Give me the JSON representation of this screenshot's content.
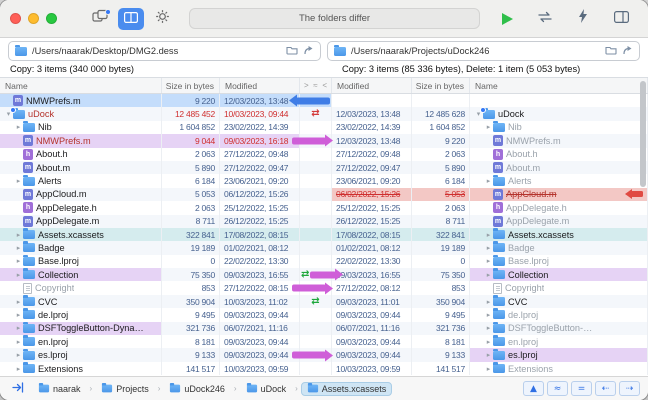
{
  "toolbar": {
    "status_text": "The folders differ",
    "icons": [
      "compare-folders",
      "dual-pane-view",
      "settings",
      "run-sync",
      "swap-sides",
      "actions",
      "layout"
    ]
  },
  "paths": {
    "left": "/Users/naarak/Desktop/DMG2.dess",
    "right": "/Users/naarak/Projects/uDock246"
  },
  "summaries": {
    "left": "Copy: 3 items (340 000 bytes)",
    "right": "Copy: 3 items (85 336 bytes), Delete: 1 item (5 053 bytes)"
  },
  "headers": {
    "left": [
      "Name",
      "Size in bytes",
      "Modified"
    ],
    "middle": [
      ">",
      "≈",
      "<"
    ],
    "right": [
      "Modified",
      "Size in bytes",
      "Name"
    ]
  },
  "colors": {
    "copy_left_blue": "#3f7de6",
    "copy_right_purple": "#cf5ed8",
    "delete_red": "#e04a42",
    "sync_green": "#1ea83c",
    "conflict_red": "#d43c3c",
    "selection_blue": "#c4ddfb",
    "selection_purple": "#e6d3f5",
    "selection_teal": "#d5ecee",
    "selection_red": "#f3c8c5"
  },
  "rows": [
    {
      "left": {
        "icon": "file-m",
        "name": "NMWPrefs.m",
        "size": "9 220",
        "modified": "12/03/2023, 13:48",
        "indent": 0
      },
      "middle": [
        "arrow-left-blue"
      ],
      "right": null,
      "hl_left": "blue",
      "hl_mid": "blue"
    },
    {
      "left": {
        "icon": "folder-badge",
        "disclosure": "open",
        "name": "uDock",
        "size": "12 485 452",
        "modified": "10/03/2023, 09:44",
        "indent": 0,
        "red": true
      },
      "middle": [
        "sync-red"
      ],
      "right": {
        "modified": "12/03/2023, 13:48",
        "size": "12 485 628",
        "name": "uDock",
        "icon": "folder-badge",
        "disclosure": "open",
        "indent": 0,
        "red": false
      }
    },
    {
      "left": {
        "icon": "folder",
        "disclosure": "closed",
        "name": "Nib",
        "size": "1 604 852",
        "modified": "23/02/2022, 14:39",
        "indent": 1
      },
      "middle": [],
      "right": {
        "modified": "23/02/2022, 14:39",
        "size": "1 604 852",
        "name": "Nib",
        "icon": "folder",
        "disclosure": "closed",
        "indent": 1,
        "gray": true
      }
    },
    {
      "left": {
        "icon": "file-m",
        "name": "NMWPrefs.m",
        "size": "9 044",
        "modified": "09/03/2023, 16:18",
        "indent": 1,
        "red": true
      },
      "middle": [
        "arrow-right-purple"
      ],
      "right": {
        "modified": "12/03/2023, 13:48",
        "size": "9 220",
        "name": "NMWPrefs.m",
        "icon": "file-m",
        "indent": 1,
        "gray": true
      },
      "hl_left": "purple"
    },
    {
      "left": {
        "icon": "file-h",
        "name": "About.h",
        "size": "2 063",
        "modified": "27/12/2022, 09:48",
        "indent": 1
      },
      "middle": [],
      "right": {
        "modified": "27/12/2022, 09:48",
        "size": "2 063",
        "name": "About.h",
        "icon": "file-h",
        "indent": 1,
        "gray": true
      }
    },
    {
      "left": {
        "icon": "file-m",
        "name": "About.m",
        "size": "5 890",
        "modified": "27/12/2022, 09:47",
        "indent": 1
      },
      "middle": [],
      "right": {
        "modified": "27/12/2022, 09:47",
        "size": "5 890",
        "name": "About.m",
        "icon": "file-m",
        "indent": 1,
        "gray": true
      }
    },
    {
      "left": {
        "icon": "folder",
        "disclosure": "closed",
        "name": "Alerts",
        "size": "6 184",
        "modified": "23/06/2021, 09:20",
        "indent": 1
      },
      "middle": [],
      "right": {
        "modified": "23/06/2021, 09:20",
        "size": "6 184",
        "name": "Alerts",
        "icon": "folder",
        "disclosure": "closed",
        "indent": 1,
        "gray": true
      }
    },
    {
      "left": {
        "icon": "file-m",
        "name": "AppCloud.m",
        "size": "5 053",
        "modified": "06/12/2022, 15:26",
        "indent": 1
      },
      "middle": [],
      "right": {
        "modified": "06/02/2022, 15:26",
        "size": "5 053",
        "name": "AppCloud.m",
        "icon": "file-m",
        "indent": 1,
        "red": true,
        "strike": true,
        "far_arrow": true
      },
      "hl_right": "red"
    },
    {
      "left": {
        "icon": "file-h",
        "name": "AppDelegate.h",
        "size": "2 063",
        "modified": "25/12/2022, 15:25",
        "indent": 1
      },
      "middle": [],
      "right": {
        "modified": "25/12/2022, 15:25",
        "size": "2 063",
        "name": "AppDelegate.h",
        "icon": "file-h",
        "indent": 1,
        "gray": true
      }
    },
    {
      "left": {
        "icon": "file-m",
        "name": "AppDelegate.m",
        "size": "8 711",
        "modified": "26/12/2022, 15:25",
        "indent": 1
      },
      "middle": [],
      "right": {
        "modified": "26/12/2022, 15:25",
        "size": "8 711",
        "name": "AppDelegate.m",
        "icon": "file-m",
        "indent": 1,
        "gray": true
      }
    },
    {
      "left": {
        "icon": "folder",
        "disclosure": "closed",
        "name": "Assets.xcassets",
        "size": "322 841",
        "modified": "17/08/2022, 08:15",
        "indent": 1
      },
      "middle": [],
      "right": {
        "modified": "17/08/2022, 08:15",
        "size": "322 841",
        "name": "Assets.xcassets",
        "icon": "folder",
        "disclosure": "closed",
        "indent": 1
      },
      "hl_left": "teal",
      "hl_mid": "teal",
      "hl_right": "teal"
    },
    {
      "left": {
        "icon": "folder",
        "disclosure": "closed",
        "name": "Badge",
        "size": "19 189",
        "modified": "01/02/2021, 08:12",
        "indent": 1
      },
      "middle": [],
      "right": {
        "modified": "01/02/2021, 08:12",
        "size": "19 189",
        "name": "Badge",
        "icon": "folder",
        "disclosure": "closed",
        "indent": 1,
        "gray": true
      }
    },
    {
      "left": {
        "icon": "folder",
        "disclosure": "closed",
        "name": "Base.lproj",
        "size": "0",
        "modified": "22/02/2022, 13:30",
        "indent": 1
      },
      "middle": [],
      "right": {
        "modified": "22/02/2022, 13:30",
        "size": "0",
        "name": "Base.lproj",
        "icon": "folder",
        "disclosure": "closed",
        "indent": 1,
        "gray": true
      }
    },
    {
      "left": {
        "icon": "folder",
        "disclosure": "closed",
        "name": "Collection",
        "size": "75 350",
        "modified": "09/03/2023, 16:55",
        "indent": 1,
        "name_hl": "purple"
      },
      "middle": [
        "sync-green",
        "arrow-right-purple"
      ],
      "right": {
        "modified": "09/03/2023, 16:55",
        "size": "75 350",
        "name": "Collection",
        "icon": "folder",
        "disclosure": "closed",
        "indent": 1,
        "name_hl": "purple"
      }
    },
    {
      "left": {
        "icon": "doc",
        "name": "Copyright",
        "size": "853",
        "modified": "27/12/2022, 08:15",
        "indent": 1,
        "gray": true
      },
      "middle": [
        "arrow-right-purple"
      ],
      "right": {
        "modified": "27/12/2022, 08:12",
        "size": "853",
        "name": "Copyright",
        "icon": "doc",
        "indent": 1,
        "gray": true
      }
    },
    {
      "left": {
        "icon": "folder",
        "disclosure": "closed",
        "name": "CVC",
        "size": "350 904",
        "modified": "10/03/2023, 11:02",
        "indent": 1
      },
      "middle": [
        "sync-green"
      ],
      "right": {
        "modified": "09/03/2023, 11:01",
        "size": "350 904",
        "name": "CVC",
        "icon": "folder",
        "disclosure": "closed",
        "indent": 1
      }
    },
    {
      "left": {
        "icon": "folder",
        "disclosure": "closed",
        "name": "de.lproj",
        "size": "9 495",
        "modified": "09/03/2023, 09:44",
        "indent": 1
      },
      "middle": [],
      "right": {
        "modified": "09/03/2023, 09:44",
        "size": "9 495",
        "name": "de.lproj",
        "icon": "folder",
        "disclosure": "closed",
        "indent": 1,
        "gray": true
      }
    },
    {
      "left": {
        "icon": "folder",
        "disclosure": "closed",
        "name": "DSFToggleButton-Dyna…",
        "size": "321 736",
        "modified": "06/07/2021, 11:16",
        "indent": 1,
        "name_hl": "purple"
      },
      "middle": [],
      "right": {
        "modified": "06/07/2021, 11:16",
        "size": "321 736",
        "name": "DSFToggleButton-…",
        "icon": "folder",
        "disclosure": "closed",
        "indent": 1,
        "gray": true
      }
    },
    {
      "left": {
        "icon": "folder",
        "disclosure": "closed",
        "name": "en.lproj",
        "size": "8 181",
        "modified": "09/03/2023, 09:44",
        "indent": 1
      },
      "middle": [],
      "right": {
        "modified": "09/03/2023, 09:44",
        "size": "8 181",
        "name": "en.lproj",
        "icon": "folder",
        "disclosure": "closed",
        "indent": 1,
        "gray": true
      }
    },
    {
      "left": {
        "icon": "folder",
        "disclosure": "closed",
        "name": "es.lproj",
        "size": "9 133",
        "modified": "09/03/2023, 09:44",
        "indent": 1
      },
      "middle": [
        "arrow-right-purple"
      ],
      "right": {
        "modified": "09/03/2023, 09:44",
        "size": "9 133",
        "name": "es.lproj",
        "icon": "folder",
        "disclosure": "closed",
        "indent": 1,
        "name_hl": "purple"
      }
    },
    {
      "left": {
        "icon": "folder",
        "disclosure": "closed",
        "name": "Extensions",
        "size": "141 517",
        "modified": "10/03/2023, 09:59",
        "indent": 1
      },
      "middle": [],
      "right": {
        "modified": "10/03/2023, 09:59",
        "size": "141 517",
        "name": "Extensions",
        "icon": "folder",
        "disclosure": "closed",
        "indent": 1,
        "gray": true
      }
    }
  ],
  "footer": {
    "breadcrumbs": [
      "naarak",
      "Projects",
      "uDock246",
      "uDock",
      "Assets.xcassets"
    ],
    "breadcrumb_separator": "›",
    "filters": [
      {
        "name": "filter-conflicts-button",
        "glyph": "▲"
      },
      {
        "name": "filter-different-button",
        "glyph": "≈"
      },
      {
        "name": "filter-equal-button",
        "glyph": "="
      },
      {
        "name": "filter-left-orphans-button",
        "glyph": "⇠"
      },
      {
        "name": "filter-right-orphans-button",
        "glyph": "⇢"
      }
    ]
  }
}
